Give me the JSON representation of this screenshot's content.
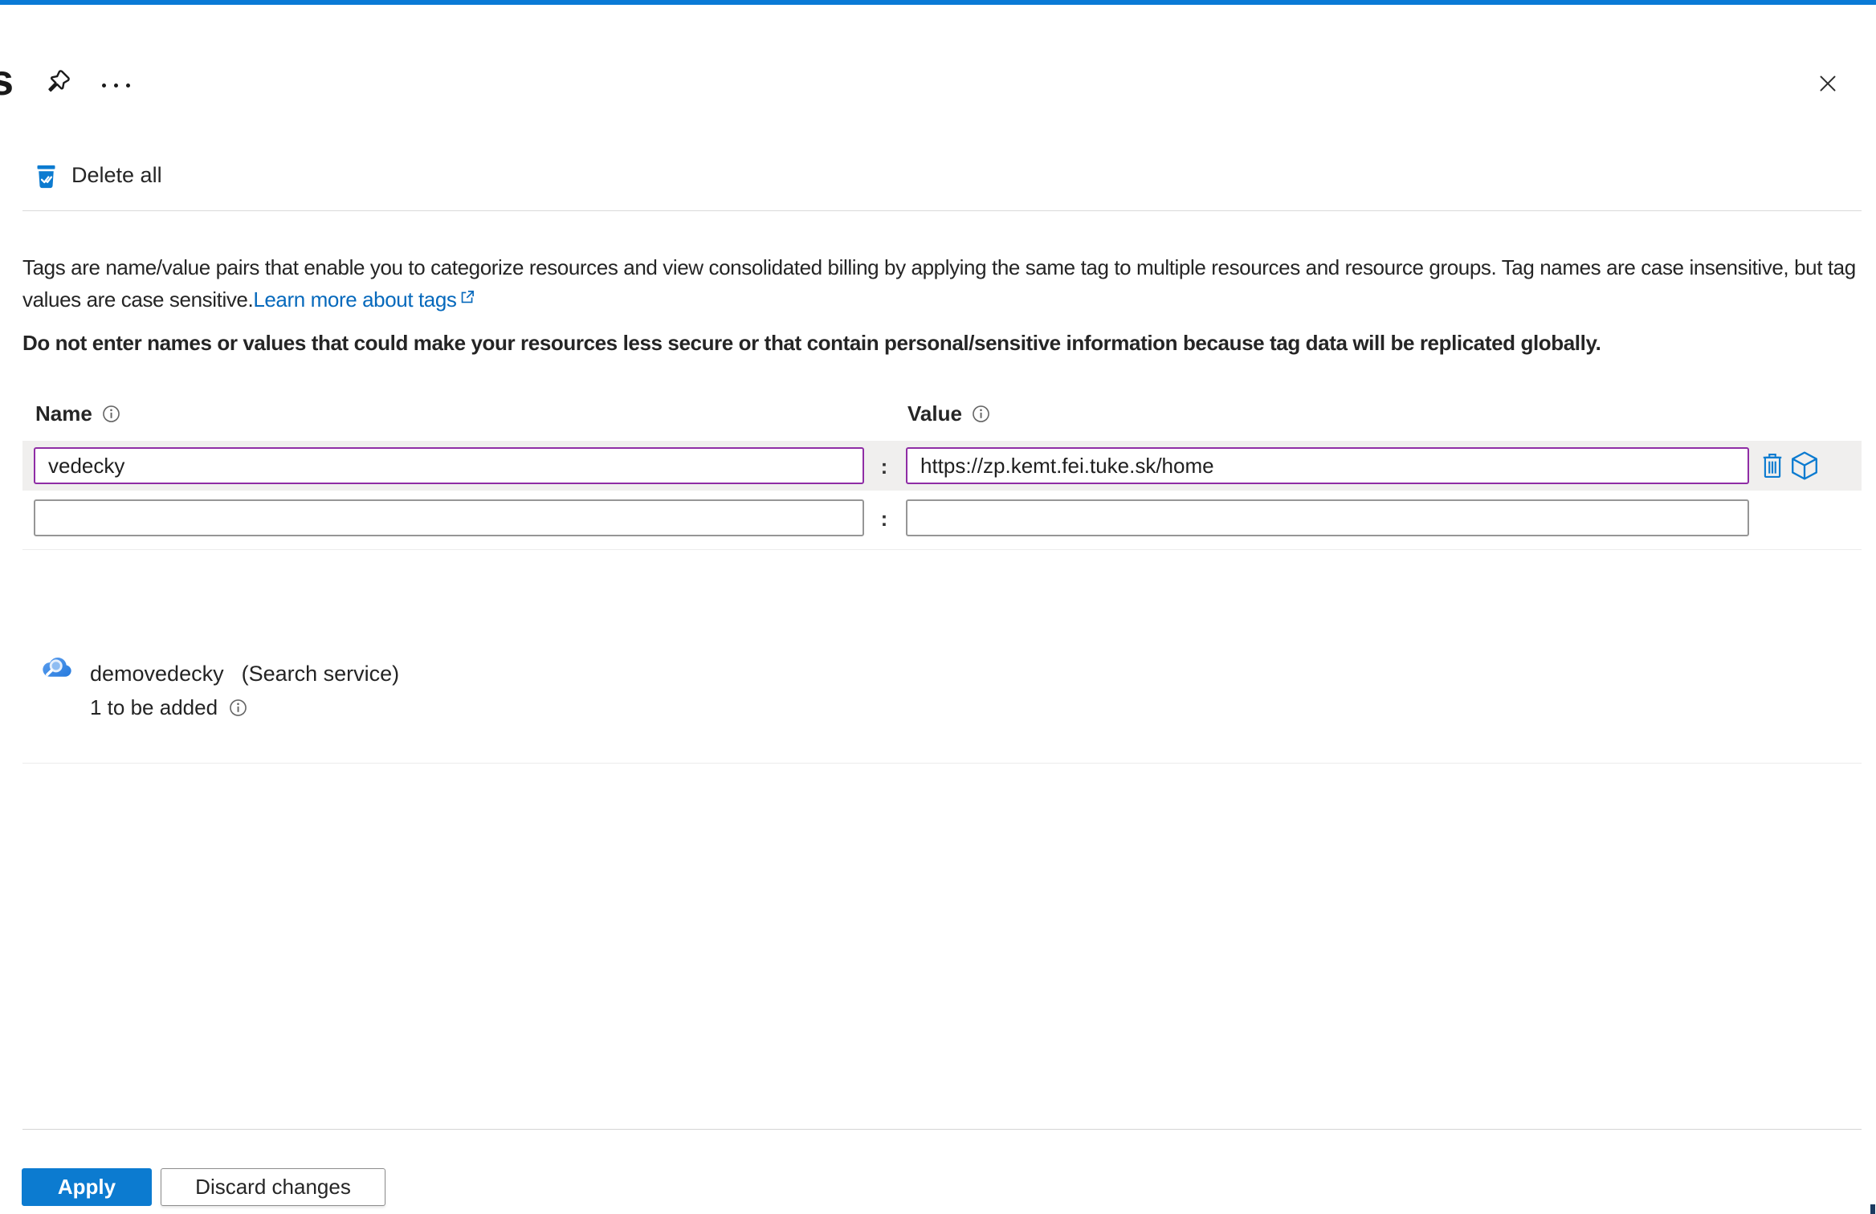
{
  "panel": {
    "title_fragment": "s"
  },
  "toolbar": {
    "delete_all_label": "Delete all"
  },
  "intro": {
    "body": "Tags are name/value pairs that enable you to categorize resources and view consolidated billing by applying the same tag to multiple resources and resource groups. Tag names are case insensitive, but tag values are case sensitive.",
    "link_label": "Learn more about tags",
    "warning": "Do not enter names or values that could make your resources less secure or that contain personal/sensitive information because tag data will be replicated globally."
  },
  "tag_editor": {
    "name_header": "Name",
    "value_header": "Value",
    "separator": ":",
    "rows": [
      {
        "name": "vedecky",
        "value": "https://zp.kemt.fei.tuke.sk/home",
        "modified": true
      },
      {
        "name": "",
        "value": "",
        "modified": false
      }
    ]
  },
  "resources": {
    "items": [
      {
        "name": "demovedecky",
        "type_label": "(Search service)",
        "status": "1 to be added"
      }
    ]
  },
  "footer": {
    "apply_label": "Apply",
    "discard_label": "Discard changes"
  },
  "icons": {
    "pin": "pin-icon",
    "more": "more-options-icon",
    "close": "close-icon",
    "delete_all": "delete-all-icon",
    "info": "info-icon",
    "external_link": "external-link-icon",
    "delete_row": "trash-icon",
    "resource": "cube-icon",
    "search_service": "search-service-icon"
  },
  "colors": {
    "top_bar": "#0a7ad6",
    "accent_blue": "#0c7bd0",
    "modified_purple": "#8f2da5",
    "link_blue": "#0669bc",
    "row_highlight": "#f0efee"
  }
}
